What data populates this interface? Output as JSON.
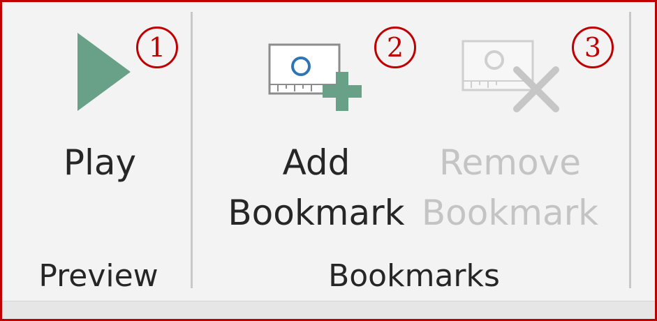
{
  "ribbon": {
    "groups": [
      {
        "label": "Preview",
        "buttons": [
          {
            "label_lines": [
              "Play"
            ],
            "icon": "play-icon",
            "enabled": true,
            "callout": "1"
          }
        ]
      },
      {
        "label": "Bookmarks",
        "buttons": [
          {
            "label_lines": [
              "Add",
              "Bookmark"
            ],
            "icon": "add-bookmark-icon",
            "enabled": true,
            "callout": "2"
          },
          {
            "label_lines": [
              "Remove",
              "Bookmark"
            ],
            "icon": "remove-bookmark-icon",
            "enabled": false,
            "callout": "3"
          }
        ]
      }
    ]
  },
  "colors": {
    "accent_green": "#68a088",
    "callout_red": "#c00000",
    "disabled_text": "#c4c4c4",
    "text": "#262626",
    "frame_border": "#c00000"
  }
}
